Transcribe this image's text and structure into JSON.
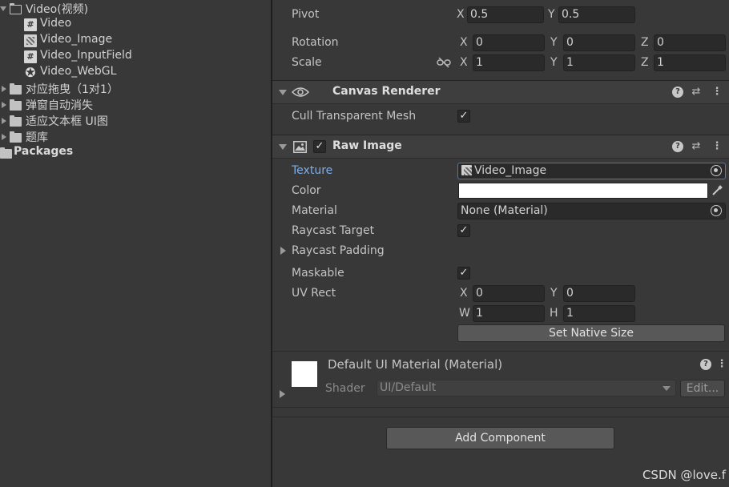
{
  "project": {
    "items": [
      {
        "label": "Video(视频)"
      },
      {
        "label": "Video"
      },
      {
        "label": "Video_Image"
      },
      {
        "label": "Video_InputField"
      },
      {
        "label": "Video_WebGL"
      },
      {
        "label": "对应拖曳（1对1）"
      },
      {
        "label": "弹窗自动消失"
      },
      {
        "label": "适应文本框 UI图"
      },
      {
        "label": "题库"
      },
      {
        "label": "Packages"
      }
    ],
    "icons": {
      "script": "#",
      "unity": "✪"
    }
  },
  "transform": {
    "pivot_label": "Pivot",
    "pivot_x": "0.5",
    "pivot_y": "0.5",
    "rotation_label": "Rotation",
    "rotation": {
      "x": "0",
      "y": "0",
      "z": "0"
    },
    "scale_label": "Scale",
    "scale": {
      "x": "1",
      "y": "1",
      "z": "1"
    },
    "axis": {
      "x": "X",
      "y": "Y",
      "z": "Z",
      "w": "W",
      "h": "H"
    }
  },
  "canvas_renderer": {
    "title": "Canvas Renderer",
    "cull_label": "Cull Transparent Mesh",
    "cull_checked": "✓"
  },
  "raw_image": {
    "title": "Raw Image",
    "enabled_check": "✓",
    "texture_label": "Texture",
    "texture_value": "Video_Image",
    "color_label": "Color",
    "material_label": "Material",
    "material_value": "None (Material)",
    "raycast_target_label": "Raycast Target",
    "raycast_target_check": "✓",
    "raycast_padding_label": "Raycast Padding",
    "maskable_label": "Maskable",
    "maskable_check": "✓",
    "uv_rect_label": "UV Rect",
    "uv": {
      "x": "0",
      "y": "0",
      "w": "1",
      "h": "1"
    },
    "native_size_button": "Set Native Size"
  },
  "material": {
    "title": "Default UI Material (Material)",
    "shader_label": "Shader",
    "shader_value": "UI/Default",
    "edit_button": "Edit..."
  },
  "add_component_button": "Add Component",
  "watermark": "CSDN @love.f",
  "colors": {
    "background": "#383838",
    "header": "#3e3e3e",
    "field": "#2a2a2a",
    "link": "#7eaee8"
  }
}
